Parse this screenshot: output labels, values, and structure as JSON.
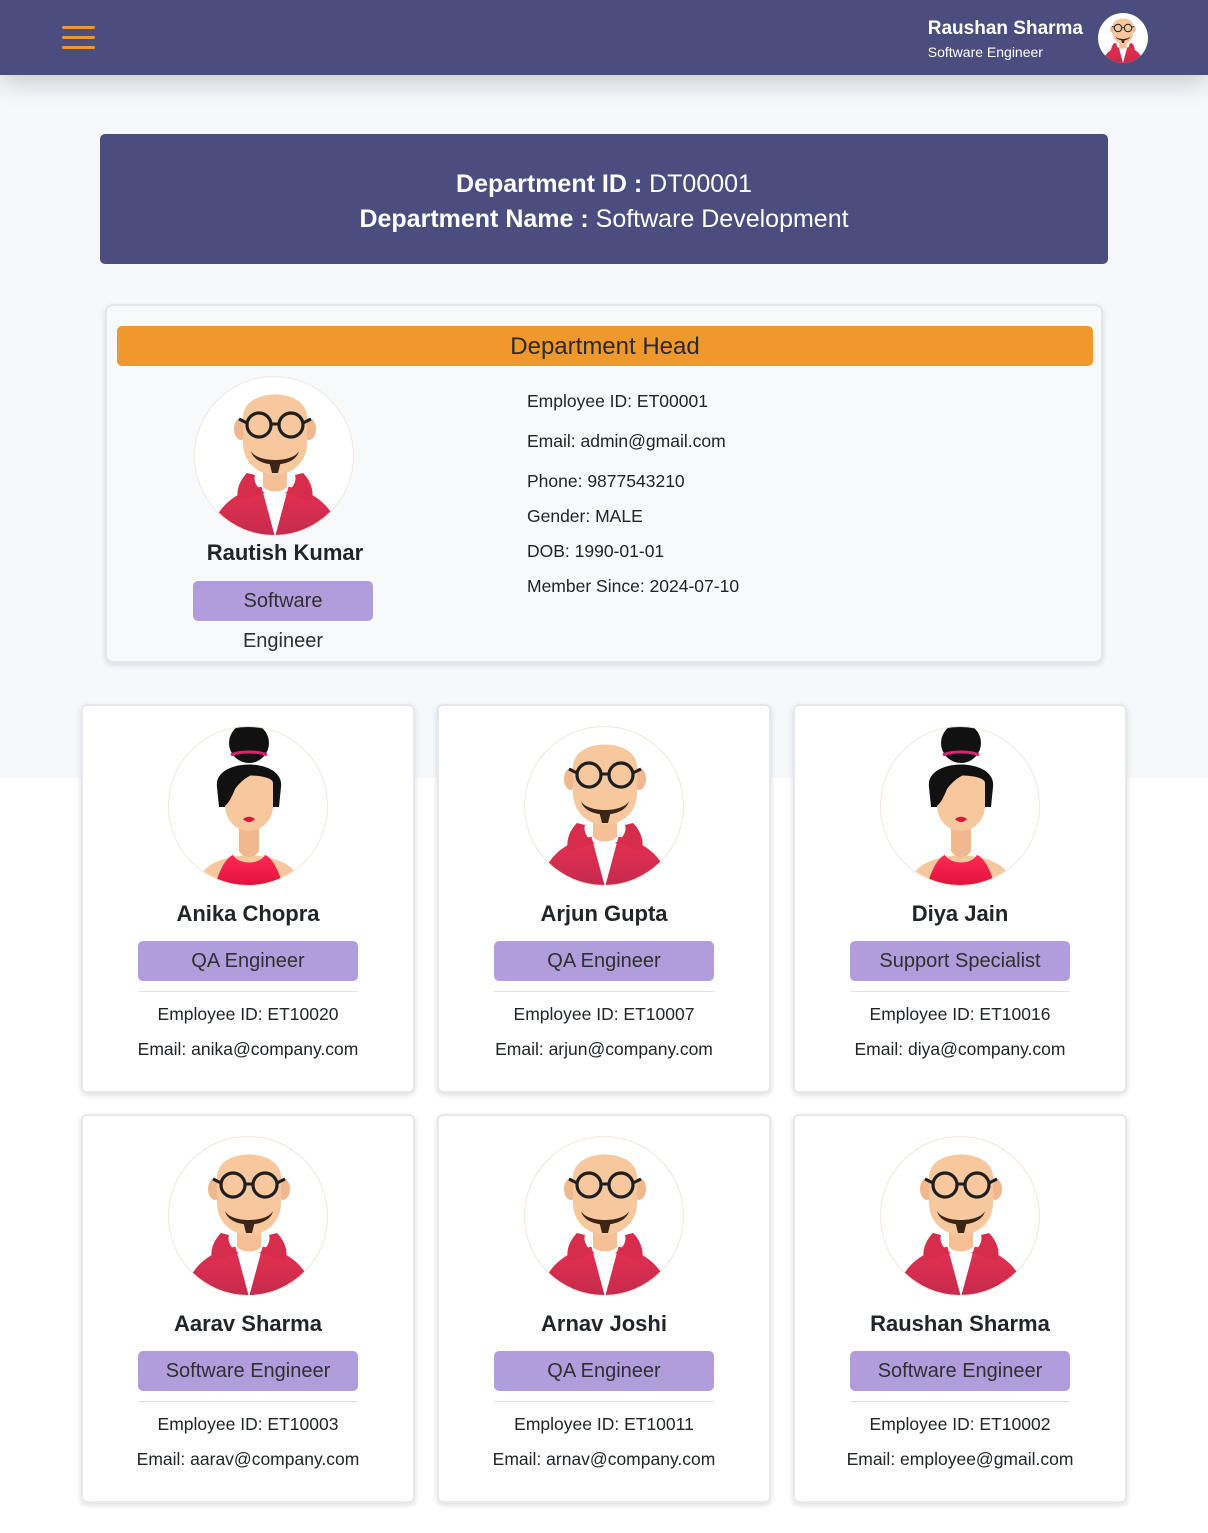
{
  "header": {
    "user_name": "Raushan Sharma",
    "user_role": "Software Engineer",
    "menu_icon": "hamburger-menu-icon",
    "accent_color": "#f0982c",
    "bar_color": "#4a4d7e"
  },
  "department": {
    "id_label": "Department ID :",
    "id_value": "DT00001",
    "name_label": "Department Name :",
    "name_value": "Software Development"
  },
  "head": {
    "section_title": "Department Head",
    "name": "Rautish Kumar",
    "role": "Software Engineer",
    "employee_id": "Employee ID: ET00001",
    "email": "Email: admin@gmail.com",
    "phone": "Phone: 9877543210",
    "gender": "Gender: MALE",
    "dob": "DOB: 1990-01-01",
    "member_since": "Member Since: 2024-07-10",
    "avatar": "male-avatar-icon"
  },
  "employees": [
    {
      "name": "Anika Chopra",
      "role": "QA Engineer",
      "employee_id": "Employee ID: ET10020",
      "email": "Email: anika@company.com",
      "avatar": "female-avatar-icon"
    },
    {
      "name": "Arjun Gupta",
      "role": "QA Engineer",
      "employee_id": "Employee ID: ET10007",
      "email": "Email: arjun@company.com",
      "avatar": "male-avatar-icon"
    },
    {
      "name": "Diya Jain",
      "role": "Support Specialist",
      "employee_id": "Employee ID: ET10016",
      "email": "Email: diya@company.com",
      "avatar": "female-avatar-icon"
    },
    {
      "name": "Aarav Sharma",
      "role": "Software Engineer",
      "employee_id": "Employee ID: ET10003",
      "email": "Email: aarav@company.com",
      "avatar": "male-avatar-icon"
    },
    {
      "name": "Arnav Joshi",
      "role": "QA Engineer",
      "employee_id": "Employee ID: ET10011",
      "email": "Email: arnav@company.com",
      "avatar": "male-avatar-icon"
    },
    {
      "name": "Raushan Sharma",
      "role": "Software Engineer",
      "employee_id": "Employee ID: ET10002",
      "email": "Email: employee@gmail.com",
      "avatar": "male-avatar-icon"
    }
  ],
  "colors": {
    "badge": "#b29ddc",
    "head_title": "#f0982c",
    "banner": "#4a4d7e"
  }
}
